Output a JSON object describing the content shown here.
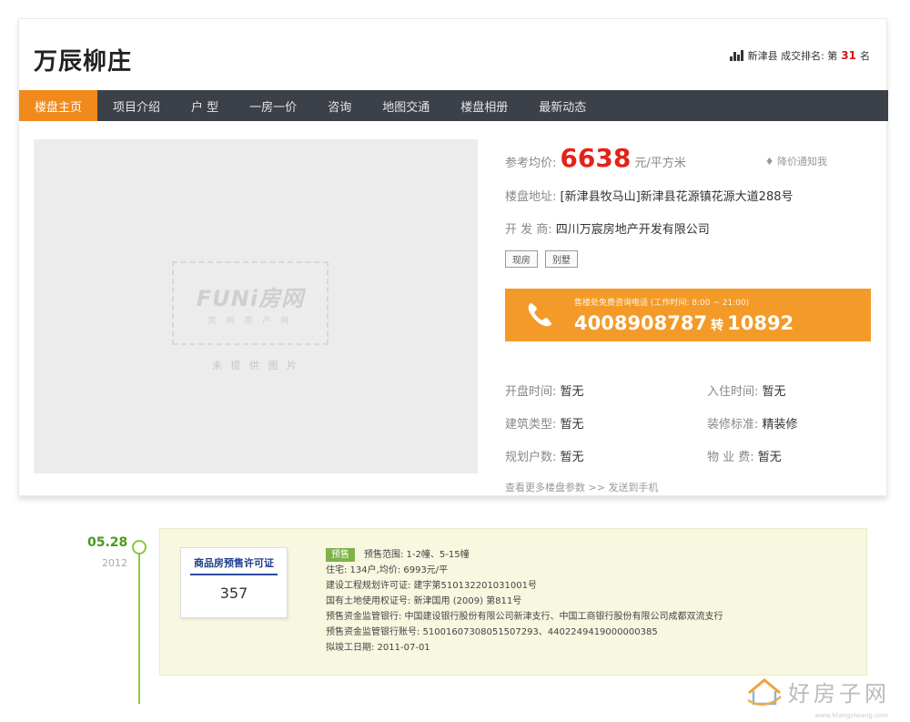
{
  "header": {
    "title": "万辰柳庄",
    "rank_prefix": "新津县 成交排名: 第",
    "rank_number": "31",
    "rank_suffix": "名"
  },
  "nav": {
    "items": [
      {
        "label": "楼盘主页",
        "active": true
      },
      {
        "label": "项目介绍",
        "active": false
      },
      {
        "label": "户 型",
        "active": false
      },
      {
        "label": "一房一价",
        "active": false
      },
      {
        "label": "咨询",
        "active": false
      },
      {
        "label": "地图交通",
        "active": false
      },
      {
        "label": "楼盘相册",
        "active": false
      },
      {
        "label": "最新动态",
        "active": false
      }
    ]
  },
  "photo": {
    "logo_main": "FUNi房网",
    "logo_sub": "房 网 房 产 网",
    "no_photo_text": "未 提 供 图 片"
  },
  "info": {
    "price_label": "参考均价:",
    "price_value": "6638",
    "price_unit": "元/平方米",
    "notify_label": "降价通知我",
    "address_label": "楼盘地址:",
    "address_value": "[新津县牧马山]新津县花源镇花源大道288号",
    "developer_label": "开 发 商:",
    "developer_value": "四川万宸房地产开发有限公司",
    "tags": [
      "现房",
      "别墅"
    ],
    "phone_note": "售楼处免费咨询电话 (工作时间: 8:00 ~ 21:00)",
    "phone_number": "4008908787",
    "phone_transfer": "转",
    "phone_ext": "10892",
    "opening_label": "开盘时间:",
    "opening_value": "暂无",
    "move_in_label": "入住时间:",
    "move_in_value": "暂无",
    "building_type_label": "建筑类型:",
    "building_type_value": "暂无",
    "decoration_label": "装修标准:",
    "decoration_value": "精装修",
    "households_label": "规划户数:",
    "households_value": "暂无",
    "property_fee_label": "物 业 费:",
    "property_fee_value": "暂无",
    "more_params": "查看更多楼盘参数",
    "send_phone": ">> 发送到手机"
  },
  "timeline": {
    "date": "05.28",
    "year": "2012",
    "cert_title": "商品房预售许可证",
    "cert_number": "357",
    "badge": "预售",
    "presale_range": "预售范围: 1-2幢、5-15幢",
    "lines": [
      "住宅: 134户,均价: 6993元/平",
      "建设工程规划许可证: 建字第510132201031001号",
      "国有土地使用权证号: 新津国用 (2009) 第811号",
      "预售资金监管银行: 中国建设银行股份有限公司新津支行、中国工商银行股份有限公司成都双流支行",
      "预售资金监管银行账号: 51001607308051507293、4402249419000000385",
      "拟竣工日期: 2011-07-01"
    ]
  },
  "watermark": {
    "text": "好房子网",
    "url": "www.hfangziwang.com"
  },
  "colors": {
    "accent_orange": "#f08a1d",
    "price_red": "#e2231a",
    "nav_bg": "#3c4048",
    "timeline_green": "#8cc63f"
  }
}
